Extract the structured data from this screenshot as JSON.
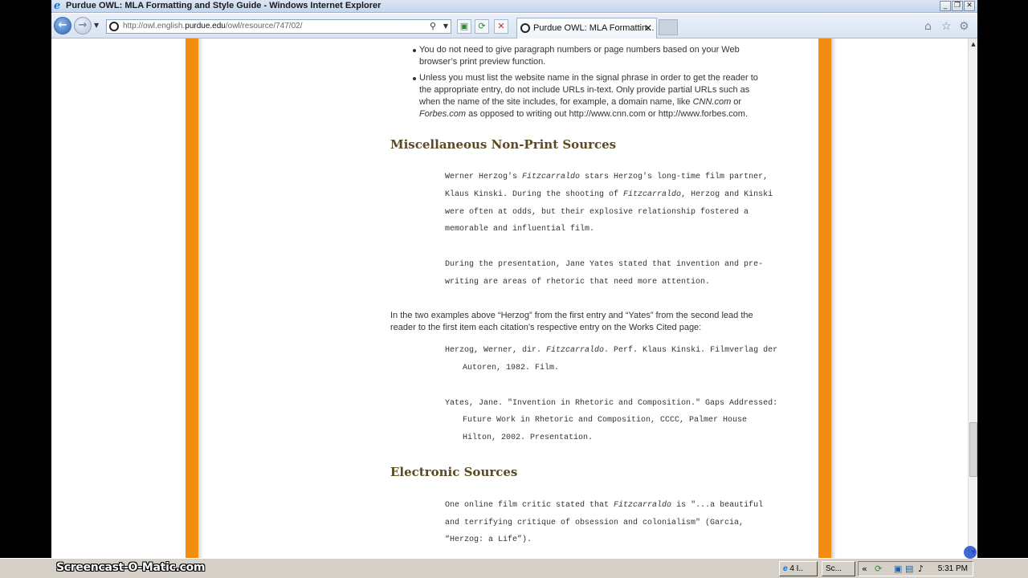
{
  "window": {
    "title": "Purdue OWL: MLA Formatting and Style Guide - Windows Internet Explorer",
    "minimize_glyph": "_",
    "restore_glyph": "❐",
    "close_glyph": "✕"
  },
  "navbar": {
    "back_glyph": "←",
    "forward_glyph": "→",
    "url_prefix": "http://owl.english.",
    "url_domain": "purdue.edu",
    "url_suffix": "/owl/resource/747/02/",
    "search_glyph": "⚲",
    "tab_label": "Purdue OWL: MLA Formattin...",
    "tab_close": "✕"
  },
  "content": {
    "bullet1_line1": "You do not need to give paragraph numbers or page numbers based on your Web",
    "bullet1_line2": "browser’s print preview function.",
    "bullet2_line1": "Unless you must list the website name in the signal phrase in order to get the reader to",
    "bullet2_line2": "the appropriate entry, do not include URLs in-text. Only provide partial URLs such as",
    "bullet2_line3a": "when the name of the site includes, for example, a domain name, like ",
    "bullet2_line3_italic": "CNN.com",
    "bullet2_line3b": " or",
    "bullet2_line4_italic": "Forbes.com",
    "bullet2_line4b": " as opposed to writing out http://www.cnn.com or http://www.forbes.com.",
    "heading_misc": "Miscellaneous Non-Print Sources",
    "ex1_line1a": "Werner Herzog's ",
    "ex1_line1_italic": "Fitzcarraldo",
    "ex1_line1b": " stars Herzog's long-time film partner,",
    "ex1_line2a": "Klaus Kinski. During the shooting of ",
    "ex1_line2_italic": "Fitzcarraldo",
    "ex1_line2b": ", Herzog and Kinski",
    "ex1_line3": "were often at odds, but their explosive relationship fostered a",
    "ex1_line4": "memorable and influential film.",
    "ex2_line1": "During the presentation, Jane Yates stated that invention and pre-",
    "ex2_line2": "writing are areas of rhetoric that need more attention.",
    "explain_line1": "In the two examples above “Herzog” from the first entry and “Yates” from the second lead the",
    "explain_line2": "reader to the first item each citation’s respective entry on the Works Cited page:",
    "wc1_line1a": "Herzog, Werner, dir. ",
    "wc1_line1_italic": "Fitzcarraldo",
    "wc1_line1b": ". Perf. Klaus Kinski. Filmverlag der",
    "wc1_line2": "Autoren, 1982. Film.",
    "wc2_line1": "Yates, Jane. \"Invention in Rhetoric and Composition.\" Gaps Addressed:",
    "wc2_line2": "Future Work in Rhetoric and Composition, CCCC, Palmer House",
    "wc2_line3": "Hilton, 2002. Presentation.",
    "heading_electronic": "Electronic Sources",
    "ex3_line1a": "One online film critic stated that ",
    "ex3_line1_italic": "Fitzcarraldo",
    "ex3_line1b": " is \"...a beautiful",
    "ex3_line2": "and terrifying critique of obsession and colonialism\" (Garcia,",
    "ex3_line3": "“Herzog: a Life”)."
  },
  "taskbar": {
    "watermark": "Screencast-O-Matic.com",
    "ie_button": "4 I..",
    "sc_button": "Sc...",
    "tray_chevron": "«",
    "clock": "5:31 PM"
  },
  "colors": {
    "accent_orange": "#f18d12",
    "heading_brown": "#5b4a22"
  }
}
